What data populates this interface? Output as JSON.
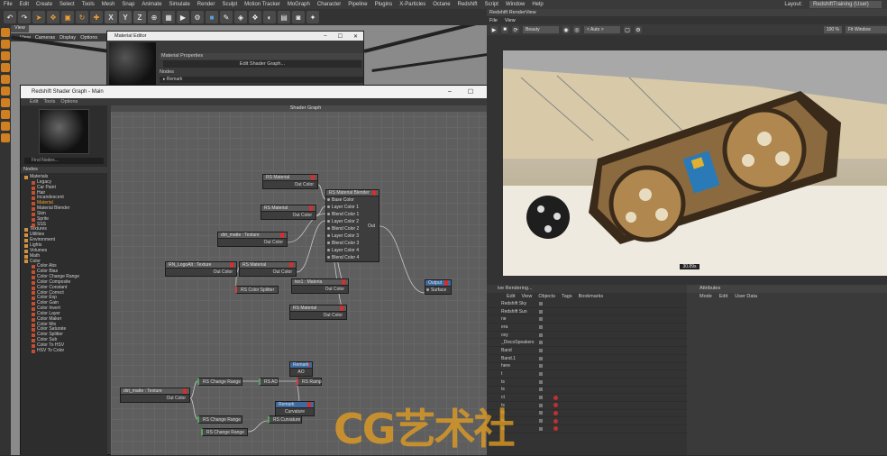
{
  "menubar": {
    "items": [
      "File",
      "Edit",
      "Create",
      "Select",
      "Tools",
      "Mesh",
      "Snap",
      "Animate",
      "Simulate",
      "Render",
      "Sculpt",
      "Motion Tracker",
      "MoGraph",
      "Character",
      "Pipeline",
      "Plugins",
      "X-Particles",
      "Octane",
      "Redshift",
      "Script",
      "Window",
      "Help"
    ],
    "layout_label": "Layout:",
    "layout_value": "RedshiftTraining (User)"
  },
  "toolbar": {
    "x": "X",
    "y": "Y",
    "z": "Z"
  },
  "viewport": {
    "tab": "View",
    "menu": [
      "View",
      "Cameras",
      "Display",
      "Options"
    ]
  },
  "material_editor": {
    "title": "Material Editor",
    "properties_label": "Material Properties",
    "edit_button": "Edit Shader Graph...",
    "nodes_label": "Nodes",
    "remark_row": "▸ Remark"
  },
  "shader_graph": {
    "title": "Redshift Shader Graph - Main",
    "menu": [
      "Edit",
      "Tools",
      "Options"
    ],
    "canvas_title": "Shader Graph",
    "find_placeholder": "Find Nodes...",
    "nodes_header": "Nodes",
    "tree": [
      {
        "label": "Materials",
        "indent": 0,
        "kind": "folder"
      },
      {
        "label": "Legacy",
        "indent": 2,
        "kind": "item"
      },
      {
        "label": "Car Paint",
        "indent": 2,
        "kind": "item"
      },
      {
        "label": "Hair",
        "indent": 2,
        "kind": "item"
      },
      {
        "label": "Incandescent",
        "indent": 2,
        "kind": "item"
      },
      {
        "label": "Material",
        "indent": 2,
        "kind": "item",
        "selected": true
      },
      {
        "label": "Material Blender",
        "indent": 2,
        "kind": "item"
      },
      {
        "label": "Skin",
        "indent": 2,
        "kind": "item"
      },
      {
        "label": "Sprite",
        "indent": 2,
        "kind": "item"
      },
      {
        "label": "SSS",
        "indent": 2,
        "kind": "item"
      },
      {
        "label": "Textures",
        "indent": 0,
        "kind": "folder"
      },
      {
        "label": "Utilities",
        "indent": 0,
        "kind": "folder"
      },
      {
        "label": "Environment",
        "indent": 0,
        "kind": "folder"
      },
      {
        "label": "Lights",
        "indent": 0,
        "kind": "folder"
      },
      {
        "label": "Volumes",
        "indent": 0,
        "kind": "folder"
      },
      {
        "label": "Math",
        "indent": 0,
        "kind": "folder"
      },
      {
        "label": "Color",
        "indent": 0,
        "kind": "folder"
      },
      {
        "label": "Color Abs",
        "indent": 2,
        "kind": "item"
      },
      {
        "label": "Color Bias",
        "indent": 2,
        "kind": "item"
      },
      {
        "label": "Color Change Range",
        "indent": 2,
        "kind": "item"
      },
      {
        "label": "Color Composite",
        "indent": 2,
        "kind": "item"
      },
      {
        "label": "Color Constant",
        "indent": 2,
        "kind": "item"
      },
      {
        "label": "Color Correct",
        "indent": 2,
        "kind": "item"
      },
      {
        "label": "Color Exp",
        "indent": 2,
        "kind": "item"
      },
      {
        "label": "Color Gain",
        "indent": 2,
        "kind": "item"
      },
      {
        "label": "Color Invert",
        "indent": 2,
        "kind": "item"
      },
      {
        "label": "Color Layer",
        "indent": 2,
        "kind": "item"
      },
      {
        "label": "Color Maker",
        "indent": 2,
        "kind": "item"
      },
      {
        "label": "Color Mix",
        "indent": 2,
        "kind": "item"
      },
      {
        "label": "Color Saturate",
        "indent": 2,
        "kind": "item"
      },
      {
        "label": "Color Splitter",
        "indent": 2,
        "kind": "item"
      },
      {
        "label": "Color Sub",
        "indent": 2,
        "kind": "item"
      },
      {
        "label": "Color To HSV",
        "indent": 2,
        "kind": "item"
      },
      {
        "label": "HSV To Color",
        "indent": 2,
        "kind": "item"
      }
    ],
    "nodes": {
      "rsmat1": {
        "title": "RS Material",
        "out": "Out Color"
      },
      "rsmat2": {
        "title": "RS Material",
        "out": "Out Color"
      },
      "dirt1": {
        "title": "dirt_matte : Texture",
        "out": "Out Color"
      },
      "rsmat3": {
        "title": "RS Material",
        "out": "Out Color"
      },
      "logotex": {
        "title": "RN_LogoAlt : Texture",
        "out": "Out Color"
      },
      "splitter": {
        "title": "RS Color Splitter"
      },
      "tex_mat": {
        "title": "tex1 : Materia",
        "out": "Out Color"
      },
      "rsmat4": {
        "title": "RS Material",
        "out": "Out Color"
      },
      "blender": {
        "title": "RS Material Blender",
        "inputs": [
          "Base Color",
          "Layer Color 1",
          "Blend Color 1",
          "Layer Color 2",
          "Blend Color 2",
          "Layer Color 3",
          "Blend Color 3",
          "Layer Color 4",
          "Blend Color 4"
        ],
        "out": "Out"
      },
      "output": {
        "title": "Output",
        "in": "Surface"
      },
      "remark_ao": {
        "title": "Remark",
        "body": "AO"
      },
      "dirt2": {
        "title": "dirt_matte : Texture",
        "out": "Out Color"
      },
      "cr1": {
        "title": "RS Change Range"
      },
      "rsao": {
        "title": "RS AO"
      },
      "ramp": {
        "title": "RS Ramp"
      },
      "remark_curv": {
        "title": "Remark",
        "body": "Curvature"
      },
      "cr2": {
        "title": "RS Change Range"
      },
      "curvature": {
        "title": "RS Curvature"
      },
      "cr3": {
        "title": "RS Change Range"
      }
    }
  },
  "render_view": {
    "title": "Redshift RenderView",
    "menu": [
      "File",
      "View"
    ],
    "beauty_select": "Beauty",
    "auto_select": "< Auto >",
    "zoom": "100 %",
    "fit": "Fit Window",
    "status_time": "30.89s"
  },
  "object_manager": {
    "header": "ive Rendering...",
    "menu": [
      "Edit",
      "View",
      "Objects",
      "Tags",
      "Bookmarks"
    ],
    "rows": [
      "Redshift Sky",
      "Redshift Sun",
      "ne",
      "era",
      "oxy",
      "_DiscoSpeakers",
      "Band",
      "Band.1",
      "here",
      "t",
      "ts",
      "ts",
      "ct",
      "ts",
      "ts",
      "ts",
      "ts"
    ]
  },
  "attributes": {
    "header": "Attributes",
    "menu": [
      "Mode",
      "Edit",
      "User Data"
    ]
  },
  "watermark": "CG艺术社",
  "colors": {
    "accent": "#e8a020",
    "node_header_red": "#d03030",
    "selection": "#3d6aa0"
  }
}
